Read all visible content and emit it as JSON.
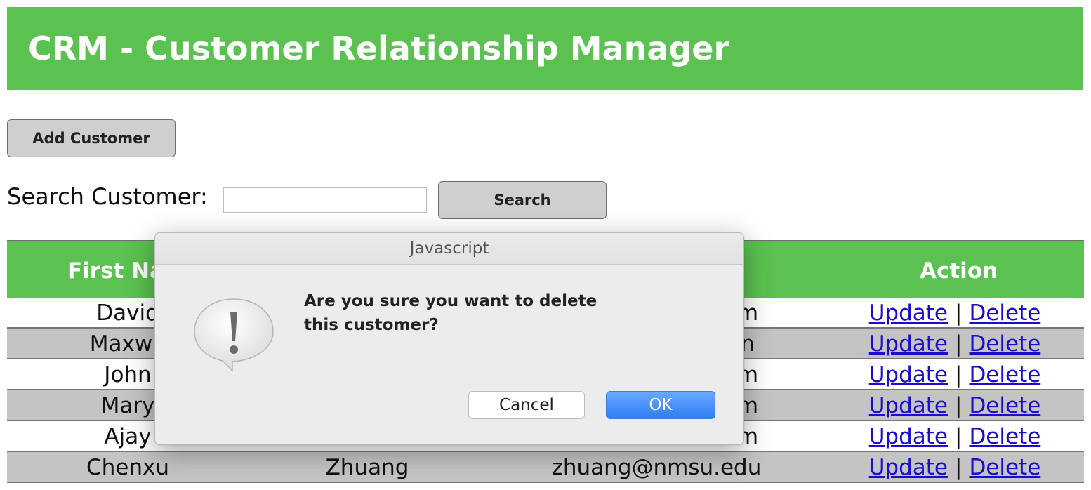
{
  "header": {
    "title": "CRM - Customer Relationship Manager"
  },
  "toolbar": {
    "add_label": "Add Customer"
  },
  "search": {
    "label": "Search Customer:",
    "value": "",
    "placeholder": "",
    "button_label": "Search"
  },
  "table": {
    "headers": {
      "first": "First Na",
      "action": "Action"
    },
    "rows": [
      {
        "first": "David",
        "last": "",
        "email": "m"
      },
      {
        "first": "Maxwe",
        "last": "",
        "email": "n"
      },
      {
        "first": "John",
        "last": "",
        "email": "m"
      },
      {
        "first": "Mary",
        "last": "",
        "email": "m"
      },
      {
        "first": "Ajay",
        "last": "",
        "email": "m"
      },
      {
        "first": "Chenxu",
        "last": "Zhuang",
        "email": "zhuang@nmsu.edu"
      }
    ],
    "update_label": "Update",
    "delete_label": "Delete",
    "separator": "|"
  },
  "dialog": {
    "title": "Javascript",
    "message": "Are you sure you want to delete this customer?",
    "icon": "alert-icon",
    "cancel_label": "Cancel",
    "ok_label": "OK"
  },
  "colors": {
    "header_green": "#5bc150",
    "row_gray": "#c4c4c4",
    "link_blue": "#1a0dcc",
    "ok_blue": "#2f7ef5"
  }
}
